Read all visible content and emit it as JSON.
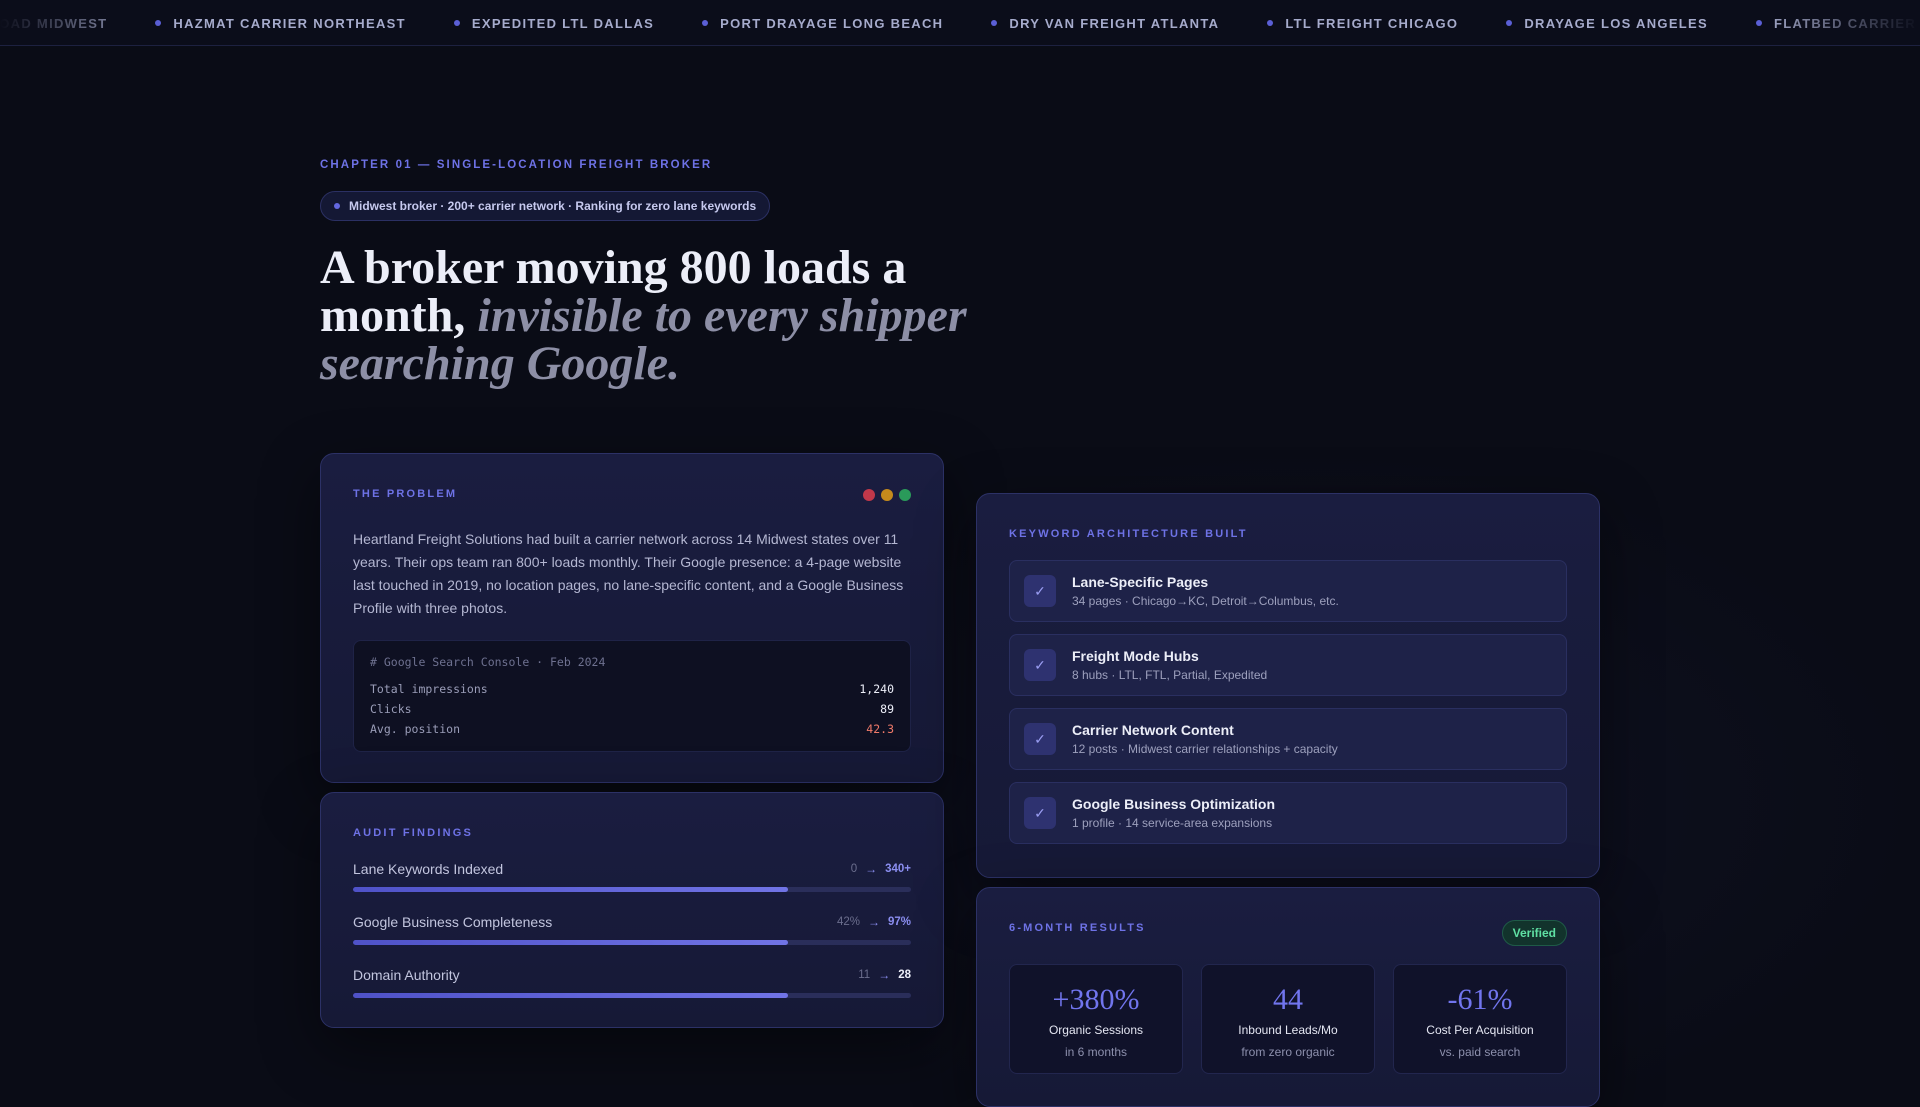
{
  "ticker": {
    "items": [
      "TRUCKLOAD MIDWEST",
      "HAZMAT CARRIER NORTHEAST",
      "EXPEDITED LTL DALLAS",
      "PORT DRAYAGE LONG BEACH",
      "DRY VAN FREIGHT ATLANTA",
      "LTL FREIGHT CHICAGO",
      "DRAYAGE LOS ANGELES",
      "FLATBED CARRIER TEXAS"
    ]
  },
  "hero": {
    "chapter": "CHAPTER 01 — SINGLE-LOCATION FREIGHT BROKER",
    "pill": "Midwest broker · 200+ carrier network · Ranking for zero lane keywords",
    "headline_plain": "A broker moving 800 loads a month,",
    "headline_italic": "invisible to every shipper searching Google."
  },
  "problem": {
    "label": "THE PROBLEM",
    "text": "Heartland Freight Solutions had built a carrier network across 14 Midwest states over 11 years. Their ops team ran 800+ loads monthly. Their Google presence: a 4-page website last touched in 2019, no location pages, no lane-specific content, and a Google Business Profile with three photos.",
    "console": {
      "header": "# Google Search Console · Feb 2024",
      "rows": [
        {
          "key": "Total impressions",
          "value": "1,240",
          "color": "#eceef8"
        },
        {
          "key": "Clicks",
          "value": "89",
          "color": "#eceef8"
        },
        {
          "key": "Avg. position",
          "value": "42.3",
          "color": "#f07a6a"
        }
      ]
    },
    "window_dots": [
      "#c0384a",
      "#c48a1c",
      "#2a9a5a"
    ]
  },
  "audit": {
    "label": "AUDIT FINDINGS",
    "rows": [
      {
        "name": "Lane Keywords Indexed",
        "from": "0",
        "to": "340+",
        "fill": 0.78,
        "accent": true
      },
      {
        "name": "Google Business Completeness",
        "from": "42%",
        "to": "97%",
        "fill": 0.78,
        "accent": true
      },
      {
        "name": "Domain Authority",
        "from": "11",
        "to": "28",
        "fill": 0.78,
        "accent": false
      }
    ]
  },
  "keywords": {
    "label": "KEYWORD ARCHITECTURE BUILT",
    "items": [
      {
        "title": "Lane-Specific Pages",
        "sub": "34 pages · Chicago→KC, Detroit→Columbus, etc."
      },
      {
        "title": "Freight Mode Hubs",
        "sub": "8 hubs · LTL, FTL, Partial, Expedited"
      },
      {
        "title": "Carrier Network Content",
        "sub": "12 posts · Midwest carrier relationships + capacity"
      },
      {
        "title": "Google Business Optimization",
        "sub": "1 profile · 14 service-area expansions"
      }
    ]
  },
  "results": {
    "label": "6-MONTH RESULTS",
    "badge": "Verified",
    "stats": [
      {
        "value": "+380%",
        "label": "Organic Sessions",
        "sub": "in 6 months"
      },
      {
        "value": "44",
        "label": "Inbound Leads/Mo",
        "sub": "from zero organic"
      },
      {
        "value": "-61%",
        "label": "Cost Per Acquisition",
        "sub": "vs. paid search"
      }
    ]
  },
  "colors": {
    "accent": "#6e72e6",
    "background": "#0a0c16",
    "card": "#1a1d40",
    "success": "#5fe0a3",
    "danger": "#f07a6a"
  },
  "icons": {
    "ticker_bullet": "dot-icon",
    "audit_arrow": "arrow-right-icon",
    "keyword_check": "check-icon"
  }
}
